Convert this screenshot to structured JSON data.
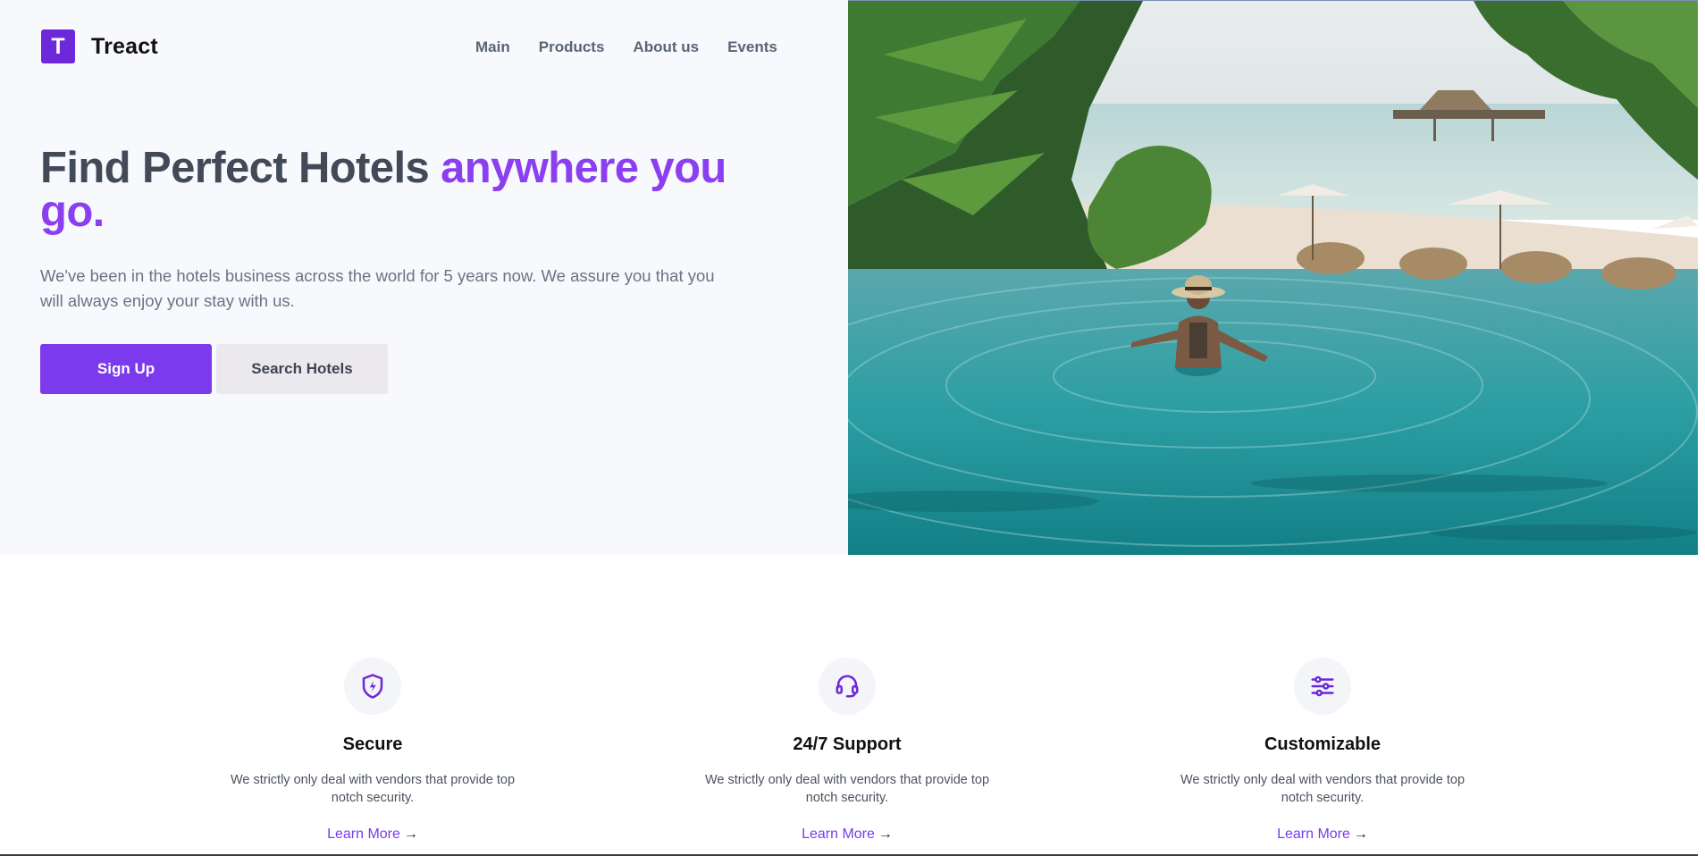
{
  "brand": {
    "logo_letter": "T",
    "name": "Treact",
    "accent_color": "#7c3aed"
  },
  "nav": {
    "items": [
      "Main",
      "Products",
      "About us",
      "Events"
    ]
  },
  "hero": {
    "headline_main": "Find Perfect Hotels ",
    "headline_accent": "anywhere you go.",
    "description": "We've been in the hotels business across the world for 5 years now. We assure you that you will always enjoy your stay with us.",
    "primary_button": "Sign Up",
    "secondary_button": "Search Hotels"
  },
  "features": [
    {
      "icon": "shield-bolt-icon",
      "title": "Secure",
      "description": "We strictly only deal with vendors that provide top notch security.",
      "link": "Learn More"
    },
    {
      "icon": "headset-icon",
      "title": "24/7 Support",
      "description": "We strictly only deal with vendors that provide top notch security.",
      "link": "Learn More"
    },
    {
      "icon": "sliders-icon",
      "title": "Customizable",
      "description": "We strictly only deal with vendors that provide top notch security.",
      "link": "Learn More"
    }
  ]
}
